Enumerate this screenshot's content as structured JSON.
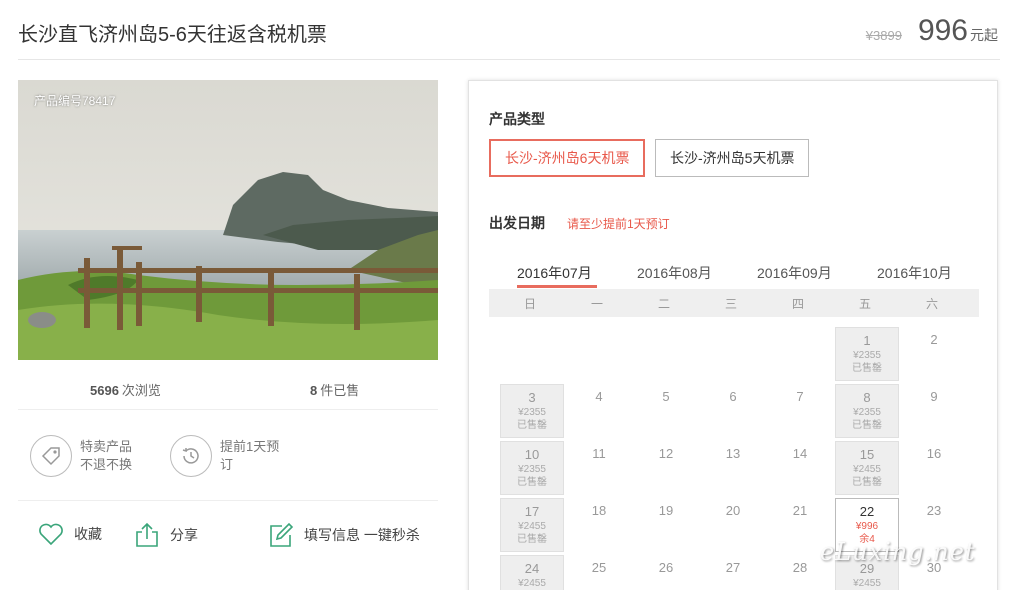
{
  "header": {
    "title": "长沙直飞济州岛5-6天往返含税机票",
    "old_price": "¥3899",
    "price": "996",
    "price_unit": "元起"
  },
  "photo": {
    "code": "产品编号78417"
  },
  "stats": {
    "views_count": "5696",
    "views_label": "次浏览",
    "sold_count": "8",
    "sold_label": "件已售"
  },
  "features": [
    {
      "icon": "tag-icon",
      "text": "特卖产品不退不换"
    },
    {
      "icon": "clock-icon",
      "text": "提前1天预订"
    }
  ],
  "actions": {
    "favorite": "收藏",
    "share": "分享",
    "fill_info": "填写信息 一键秒杀"
  },
  "booking": {
    "type_label": "产品类型",
    "types": [
      "长沙-济州岛6天机票",
      "长沙-济州岛5天机票"
    ],
    "date_label": "出发日期",
    "date_note": "请至少提前1天预订",
    "months": [
      "2016年07月",
      "2016年08月",
      "2016年09月",
      "2016年10月"
    ],
    "weekdays": [
      "日",
      "一",
      "二",
      "三",
      "四",
      "五",
      "六"
    ],
    "days": [
      {
        "d": "1",
        "price": "¥2355",
        "status": "已售罄",
        "state": "sold"
      },
      {
        "d": "2"
      },
      {
        "d": "3",
        "price": "¥2355",
        "status": "已售罄",
        "state": "sold"
      },
      {
        "d": "4"
      },
      {
        "d": "5"
      },
      {
        "d": "6"
      },
      {
        "d": "7"
      },
      {
        "d": "8",
        "price": "¥2355",
        "status": "已售罄",
        "state": "sold"
      },
      {
        "d": "9"
      },
      {
        "d": "10",
        "price": "¥2355",
        "status": "已售罄",
        "state": "sold"
      },
      {
        "d": "11"
      },
      {
        "d": "12"
      },
      {
        "d": "13"
      },
      {
        "d": "14"
      },
      {
        "d": "15",
        "price": "¥2455",
        "status": "已售罄",
        "state": "sold"
      },
      {
        "d": "16"
      },
      {
        "d": "17",
        "price": "¥2455",
        "status": "已售罄",
        "state": "sold"
      },
      {
        "d": "18"
      },
      {
        "d": "19"
      },
      {
        "d": "20"
      },
      {
        "d": "21"
      },
      {
        "d": "22",
        "price": "¥996",
        "status": "余4",
        "state": "avail"
      },
      {
        "d": "23"
      },
      {
        "d": "24",
        "price": "¥2455",
        "status": "",
        "state": "sold"
      },
      {
        "d": "25"
      },
      {
        "d": "26"
      },
      {
        "d": "27"
      },
      {
        "d": "28"
      },
      {
        "d": "29",
        "price": "¥2455",
        "status": "",
        "state": "sold"
      },
      {
        "d": "30"
      }
    ]
  },
  "watermark": "eLuxing.net",
  "colors": {
    "accent": "#e8584a",
    "icon_green": "#3aa57a"
  }
}
